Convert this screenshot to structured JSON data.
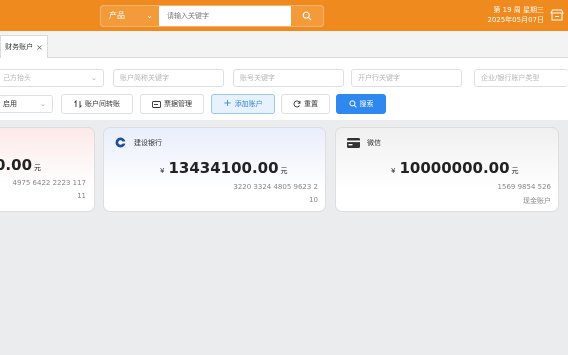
{
  "header": {
    "product_select": "产品",
    "search_placeholder": "请输入关键字",
    "week": "第 19 周  星期三",
    "date": "2025年05月07日"
  },
  "tabs": [
    {
      "label": "财务账户",
      "close": "×"
    }
  ],
  "filters": {
    "own_header": "己方抬头",
    "account_name": "账户简称关键字",
    "account_no": "账号关键字",
    "bank_branch": "开户行关键字",
    "account_type": "企业/银行账户类型",
    "status": "启用"
  },
  "buttons": {
    "transfer": "账户间转账",
    "bills": "票据管理",
    "add": "添加账户",
    "reset": "重置",
    "search": "搜索"
  },
  "cards": [
    {
      "name": "",
      "currency": "",
      "balance": "0.00",
      "unit": "元",
      "number": "4975 6422 2223 117",
      "number2": "11",
      "tag": ""
    },
    {
      "name": "建设银行",
      "currency": "¥",
      "balance": "13434100.00",
      "unit": "元",
      "number": "3220 3324 4805 9623 2",
      "number2": "10",
      "tag": ""
    },
    {
      "name": "微信",
      "currency": "¥",
      "balance": "10000000.00",
      "unit": "元",
      "number": "1569 9854 526",
      "number2": "",
      "tag": "现金账户"
    }
  ],
  "colors": {
    "accent": "#ef8a1e",
    "primary": "#2f87f0"
  }
}
